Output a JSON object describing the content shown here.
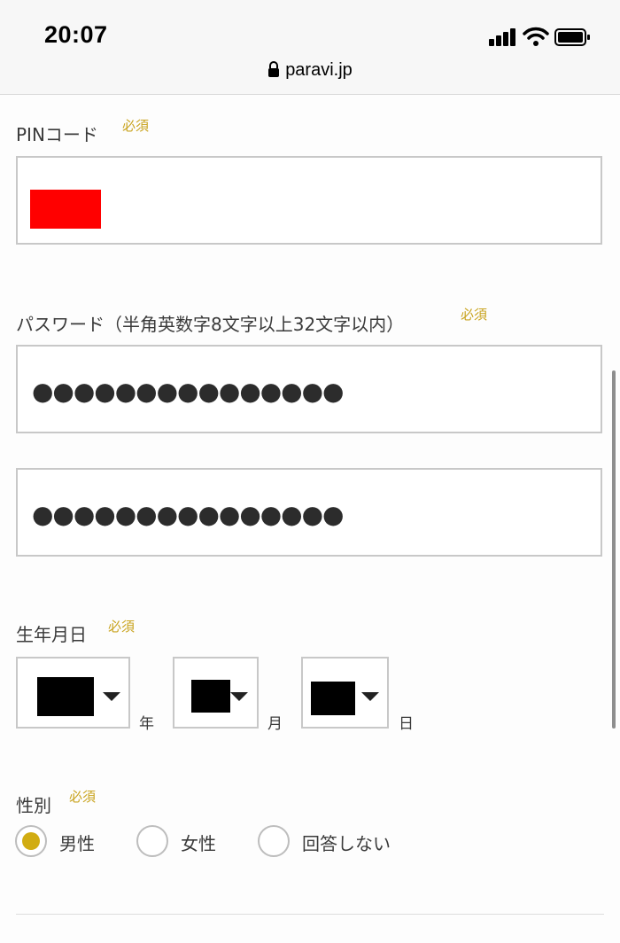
{
  "status_bar": {
    "time": "20:07",
    "url": "paravi.jp",
    "icons": [
      "signal-icon",
      "wifi-icon",
      "battery-icon",
      "lock-icon"
    ]
  },
  "form": {
    "required_label": "必須",
    "pin": {
      "label": "PINコード"
    },
    "password": {
      "label": "パスワード（半角英数字8文字以上32文字以内）",
      "value_masked": "●●●●●●●●●●●●●●●",
      "confirm_value_masked": "●●●●●●●●●●●●●●●"
    },
    "birthdate": {
      "label": "生年月日",
      "year_unit": "年",
      "month_unit": "月",
      "day_unit": "日"
    },
    "gender": {
      "label": "性別",
      "options": [
        {
          "label": "男性",
          "selected": true
        },
        {
          "label": "女性",
          "selected": false
        },
        {
          "label": "回答しない",
          "selected": false
        }
      ]
    }
  },
  "colors": {
    "accent": "#d1ac12",
    "required_text": "#c9a420",
    "border": "#c8c8c8"
  }
}
